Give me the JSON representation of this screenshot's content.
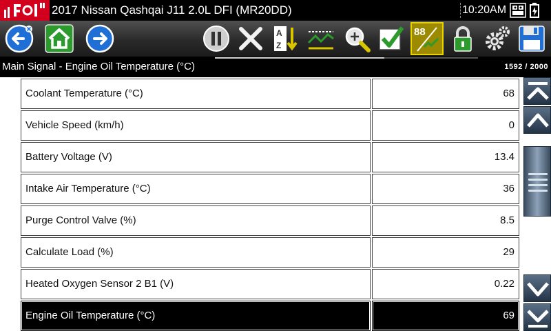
{
  "header": {
    "vehicle_title": "2017 Nissan Qashqai J11 2.0L DFI (MR20DD)",
    "time": "10:20AM"
  },
  "toolbar": {
    "buttons": [
      {
        "name": "back-button",
        "icon": "back-arrow-icon"
      },
      {
        "name": "home-button",
        "icon": "home-icon"
      },
      {
        "name": "forward-button",
        "icon": "forward-arrow-icon"
      },
      {
        "name": "pause-button",
        "icon": "pause-icon"
      },
      {
        "name": "clear-button",
        "icon": "x-icon"
      },
      {
        "name": "sort-button",
        "icon": "sort-az-icon"
      },
      {
        "name": "graph-button",
        "icon": "graph-icon"
      },
      {
        "name": "zoom-button",
        "icon": "zoom-icon"
      },
      {
        "name": "select-button",
        "icon": "checkmark-icon"
      },
      {
        "name": "pid-view-button",
        "icon": "digital-pid-icon",
        "active": true
      },
      {
        "name": "lock-button",
        "icon": "padlock-icon"
      },
      {
        "name": "settings-button",
        "icon": "gear-icon"
      },
      {
        "name": "save-button",
        "icon": "floppy-disk-icon"
      }
    ]
  },
  "subheader": {
    "title": "Main Signal - Engine Oil Temperature (°C)",
    "frame_count": "1592 / 2000",
    "frame_current": 1592,
    "frame_total": 2000
  },
  "rows": [
    {
      "name": "Coolant Temperature (°C)",
      "value": "68"
    },
    {
      "name": "Vehicle Speed (km/h)",
      "value": "0"
    },
    {
      "name": "Battery Voltage (V)",
      "value": "13.4"
    },
    {
      "name": "Intake Air Temperature (°C)",
      "value": "36"
    },
    {
      "name": "Purge Control Valve (%)",
      "value": "8.5"
    },
    {
      "name": "Calculate Load (%)",
      "value": "29"
    },
    {
      "name": "Heated Oxygen Sensor 2 B1 (V)",
      "value": "0.22"
    },
    {
      "name": "Engine Oil Temperature (°C)",
      "value": "69",
      "selected": true
    }
  ],
  "scrollbar": {
    "icons": [
      "scroll-top-icon",
      "scroll-up-icon",
      "scroll-down-icon",
      "scroll-bottom-icon"
    ]
  },
  "colors": {
    "brand_red": "#d2001c",
    "toolbar_icon_blue": "#1f6fd6",
    "toolbar_icon_green": "#2c9a2c",
    "active_highlight": "#e8d200"
  }
}
